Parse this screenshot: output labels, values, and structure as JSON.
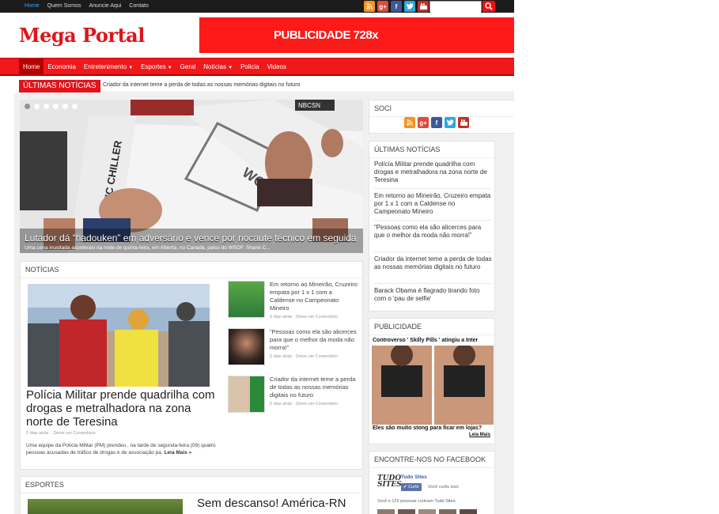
{
  "topbar": {
    "nav": [
      "Home",
      "Quem Somos",
      "Anuncie Aqui",
      "Contato"
    ],
    "search_placeholder": ""
  },
  "header": {
    "logo": "Mega Portal",
    "ad_text": "PUBLICIDADE 728x"
  },
  "mainnav": {
    "items": [
      {
        "label": "Home"
      },
      {
        "label": "Economia"
      },
      {
        "label": "Entretenimento",
        "dropdown": true
      },
      {
        "label": "Esportes",
        "dropdown": true
      },
      {
        "label": "Geral"
      },
      {
        "label": "Notícias",
        "dropdown": true
      },
      {
        "label": "Policia"
      },
      {
        "label": "Videos"
      }
    ]
  },
  "breaking": {
    "label": "ÚLTIMAS NOTÍCIAS",
    "text": "Criador da internet teme a perda de todas as nossas memórias digitais no futuro"
  },
  "slider": {
    "title": "Lutador dá “hadouken” em adversário e vence por nocaute técnico em seguida",
    "subtitle": "Uma cena inusitada aconteceu na noite de quinta-feira, em Alberta, no Canadá, palco do WSOF. Shane C...",
    "banner_text": "ARCTIC CHILLER",
    "network_text": "NBCSN"
  },
  "noticias": {
    "heading": "NOTÍCIAS",
    "featured": {
      "title": "Polícia Militar prende quadrilha com drogas e metralhadora na zona norte de Teresina",
      "date": "5 dias atrás",
      "comment": "Deixe um Comentário",
      "excerpt": "Uma equipe da Polícia Militar (PM) prendeu , na tarde de segunda-feira (09) quatro pessoas acusadas de tráfico de drogas e de associação pa.",
      "more": "Leia Mais »"
    },
    "side": [
      {
        "title": "Em retorno ao Mineirão, Cruzeiro empata por 1 x 1 com a Caldense no Campeonato Mineiro",
        "date": "5 dias atrás",
        "comment": "Deixe um Comentário"
      },
      {
        "title": "“Pessoas como ela são alicerces para que o melhor da moda não morra!”",
        "date": "5 dias atrás",
        "comment": "Deixe um Comentário"
      },
      {
        "title": "Criador da internet teme a perda de todas as nossas memórias digitais no futuro",
        "date": "5 dias atrás",
        "comment": "Deixe um Comentário"
      }
    ]
  },
  "esportes": {
    "heading": "ESPORTES",
    "title": "Sem descanso! América-RN"
  },
  "sidebar": {
    "social_heading": "SOCI",
    "ultimas_heading": "ÚLTIMAS NOTÍCIAS",
    "ultimas": [
      "Polícia Militar prende quadrilha com drogas e metralhadora na zona norte de Teresina",
      "Em retorno ao Mineirão, Cruzeiro empata por 1 x 1 com a Caldense no Campeonato Mineiro",
      "“Pessoas como ela são alicerces para que o melhor da moda não morra!”",
      "Criador da internet teme a perda de todas as nossas memórias digitais no futuro",
      "Barack Obama é flagrado tirando foto com o 'pau de selfie'"
    ],
    "publicidade_heading": "PUBLICIDADE",
    "ad_top": "Controverso ' Skilly Pills ' atingiu a Inter",
    "ad_bottom": "Eles são muito stong para ficar em lojas?",
    "ad_more": "Leia Mais",
    "fb_heading": "ENCONTRE-NOS NO FACEBOOK",
    "fb_logo_1": "TUDO",
    "fb_logo_2": "SITES",
    "fb_name": "Tudo Sites",
    "fb_like": "Curtir",
    "fb_liketxt": "Você curtiu isso",
    "fb_count_pre": "Você e 129 pessoas curtiram ",
    "fb_count_link": "Tudo Sites."
  },
  "colors": {
    "brand_red": "#e0141b",
    "nav_red": "#f0181a",
    "topbar": "#1b1b1b",
    "active_link": "#35a7ff"
  },
  "icons": {
    "social": [
      "rss-icon",
      "google-plus-icon",
      "facebook-icon",
      "twitter-icon",
      "youtube-icon"
    ],
    "search": "search-icon"
  }
}
